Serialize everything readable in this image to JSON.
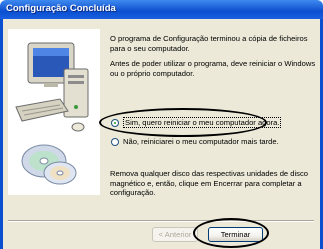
{
  "window": {
    "title": "Configuração Concluída"
  },
  "content": {
    "paragraph1": "O programa de Configuração terminou a cópia de ficheiros para o seu computador.",
    "paragraph2": "Antes de poder utilizar o programa, deve reiniciar o Windows ou o próprio computador.",
    "options": [
      {
        "label": "Sim, quero reiniciar o meu computador agora.",
        "selected": true
      },
      {
        "label": "Não, reiniciarei o meu computador mais tarde.",
        "selected": false
      }
    ],
    "paragraph3": "Remova qualquer disco das respectivas unidades de disco magnético e, então, clique em Encerrar para completar a configuração."
  },
  "buttons": {
    "back": "< Anterior",
    "finish": "Terminar"
  },
  "colors": {
    "titlebar": "#0a4fd0",
    "dialog_bg": "#ece9d8",
    "annotation": "#000000"
  },
  "icons": [
    "computer-illustration",
    "cd-disc-icon"
  ]
}
